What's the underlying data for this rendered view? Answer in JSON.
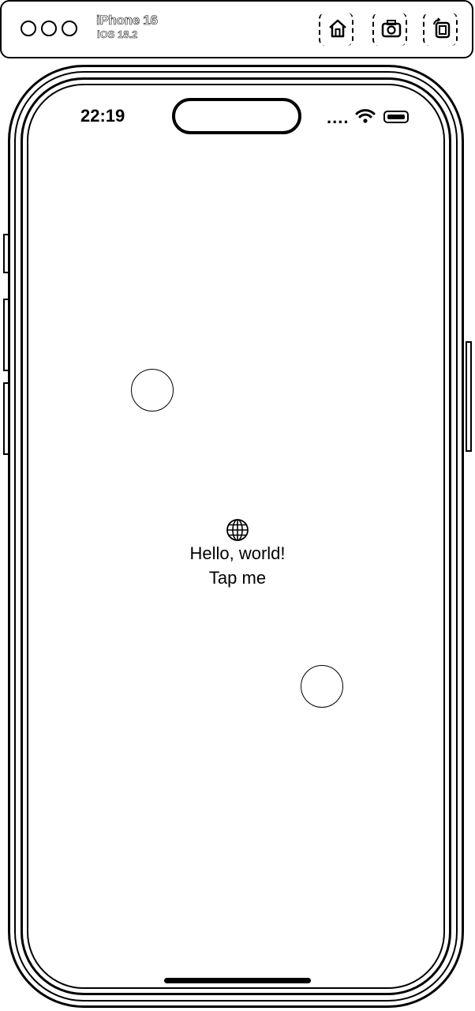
{
  "toolbar": {
    "device_name": "iPhone 16",
    "os_version": "iOS 18.2",
    "window_controls": [
      "close",
      "minimize",
      "zoom"
    ],
    "icons": [
      "home-icon",
      "screenshot-icon",
      "rotate-icon"
    ]
  },
  "status_bar": {
    "time": "22:19",
    "signal": "....",
    "icons": [
      "wifi-icon",
      "battery-icon"
    ]
  },
  "content": {
    "icon": "globe-icon",
    "greeting": "Hello, world!",
    "button_label": "Tap me"
  }
}
